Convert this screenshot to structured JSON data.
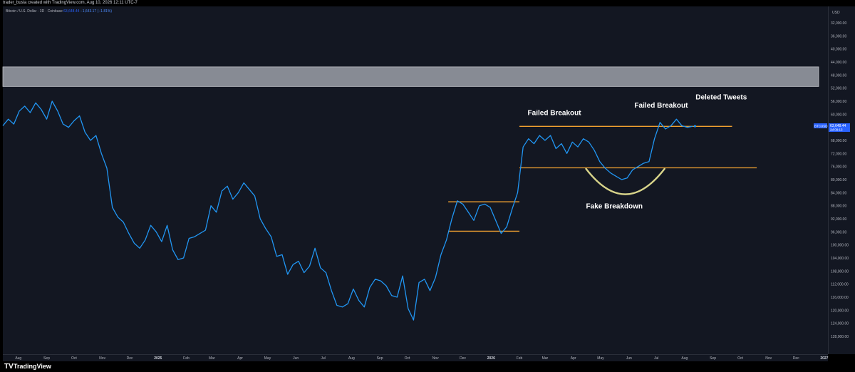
{
  "header": {
    "text": "trader_busla created with TradingView.com, Aug 10, 2026 12:11 UTC-7"
  },
  "legend": {
    "symbol": "Bitcoin / U.S. Dollar · 3D · Coinbase",
    "price": "63,648.44",
    "change": "−1,643.17 (−1.81%)"
  },
  "price_axis": {
    "currency": "USD",
    "badge_symbol": "BTCUSD",
    "badge_price": "63,648.44",
    "badge_time": "2d 09:13"
  },
  "footer": {
    "logo": "TV",
    "brand": "TradingView"
  },
  "colors": {
    "background": "#131722",
    "line": "#2196f3",
    "level": "#f0a030",
    "arc": "#d8d48a",
    "band": "#9598a1"
  },
  "chart_data": {
    "type": "line",
    "symbol": "BTCUSD",
    "y_scale": "inverted",
    "ylim": [
      30000,
      130000
    ],
    "y_ticks": [
      "32,000.00",
      "36,000.00",
      "40,000.00",
      "44,000.00",
      "48,000.00",
      "52,000.00",
      "56,000.00",
      "60,000.00",
      "64,000.00",
      "68,000.00",
      "72,000.00",
      "76,000.00",
      "80,000.00",
      "84,000.00",
      "88,000.00",
      "92,000.00",
      "96,000.00",
      "100,000.00",
      "104,000.00",
      "108,000.00",
      "112,000.00",
      "116,000.00",
      "120,000.00",
      "124,000.00",
      "128,000.00"
    ],
    "x_ticks": [
      "Aug",
      "Sep",
      "Oct",
      "Nov",
      "Dec",
      "2025",
      "Feb",
      "Mar",
      "Apr",
      "May",
      "Jun",
      "Jul",
      "Aug",
      "Sep",
      "Oct",
      "Nov",
      "Dec",
      "2026",
      "Feb",
      "Mar",
      "Apr",
      "May",
      "Jun",
      "Jul",
      "Aug",
      "Sep",
      "Oct",
      "Nov",
      "Dec",
      "2027"
    ],
    "x_range": [
      "2024-07-15",
      "2027-01-05"
    ],
    "series": [
      {
        "points": [
          [
            "2024-07-15",
            63500
          ],
          [
            "2024-07-21",
            61500
          ],
          [
            "2024-07-27",
            63000
          ],
          [
            "2024-08-02",
            59000
          ],
          [
            "2024-08-08",
            57500
          ],
          [
            "2024-08-14",
            59500
          ],
          [
            "2024-08-20",
            56500
          ],
          [
            "2024-08-26",
            58500
          ],
          [
            "2024-09-01",
            61500
          ],
          [
            "2024-09-07",
            56000
          ],
          [
            "2024-09-13",
            59000
          ],
          [
            "2024-09-19",
            63000
          ],
          [
            "2024-09-25",
            64000
          ],
          [
            "2024-10-01",
            62000
          ],
          [
            "2024-10-07",
            60500
          ],
          [
            "2024-10-13",
            65500
          ],
          [
            "2024-10-19",
            68000
          ],
          [
            "2024-10-25",
            66500
          ],
          [
            "2024-10-31",
            72000
          ],
          [
            "2024-11-06",
            76500
          ],
          [
            "2024-11-12",
            88500
          ],
          [
            "2024-11-18",
            91500
          ],
          [
            "2024-11-24",
            93000
          ],
          [
            "2024-11-30",
            96500
          ],
          [
            "2024-12-06",
            99500
          ],
          [
            "2024-12-12",
            101000
          ],
          [
            "2024-12-18",
            98500
          ],
          [
            "2024-12-24",
            94000
          ],
          [
            "2024-12-30",
            96000
          ],
          [
            "2025-01-05",
            99000
          ],
          [
            "2025-01-11",
            94000
          ],
          [
            "2025-01-17",
            101500
          ],
          [
            "2025-01-23",
            104500
          ],
          [
            "2025-01-29",
            104000
          ],
          [
            "2025-02-04",
            98000
          ],
          [
            "2025-02-10",
            97500
          ],
          [
            "2025-02-16",
            96500
          ],
          [
            "2025-02-22",
            95500
          ],
          [
            "2025-02-28",
            88000
          ],
          [
            "2025-03-06",
            90000
          ],
          [
            "2025-03-12",
            83500
          ],
          [
            "2025-03-18",
            82000
          ],
          [
            "2025-03-24",
            86000
          ],
          [
            "2025-03-30",
            84000
          ],
          [
            "2025-04-05",
            81000
          ],
          [
            "2025-04-11",
            83000
          ],
          [
            "2025-04-17",
            85000
          ],
          [
            "2025-04-23",
            92000
          ],
          [
            "2025-04-29",
            95000
          ],
          [
            "2025-05-05",
            97500
          ],
          [
            "2025-05-11",
            103500
          ],
          [
            "2025-05-17",
            103000
          ],
          [
            "2025-05-23",
            109000
          ],
          [
            "2025-05-29",
            106000
          ],
          [
            "2025-06-04",
            105000
          ],
          [
            "2025-06-10",
            108500
          ],
          [
            "2025-06-16",
            106500
          ],
          [
            "2025-06-22",
            101000
          ],
          [
            "2025-06-28",
            107000
          ],
          [
            "2025-07-04",
            108500
          ],
          [
            "2025-07-10",
            114000
          ],
          [
            "2025-07-16",
            118500
          ],
          [
            "2025-07-22",
            119000
          ],
          [
            "2025-07-28",
            118000
          ],
          [
            "2025-08-03",
            113500
          ],
          [
            "2025-08-09",
            117000
          ],
          [
            "2025-08-15",
            119000
          ],
          [
            "2025-08-21",
            113000
          ],
          [
            "2025-08-27",
            110500
          ],
          [
            "2025-09-02",
            111000
          ],
          [
            "2025-09-08",
            112500
          ],
          [
            "2025-09-14",
            115500
          ],
          [
            "2025-09-20",
            116000
          ],
          [
            "2025-09-26",
            109500
          ],
          [
            "2025-10-02",
            119500
          ],
          [
            "2025-10-08",
            123000
          ],
          [
            "2025-10-14",
            111500
          ],
          [
            "2025-10-20",
            110500
          ],
          [
            "2025-10-26",
            114000
          ],
          [
            "2025-11-01",
            110000
          ],
          [
            "2025-11-07",
            103000
          ],
          [
            "2025-11-13",
            98500
          ],
          [
            "2025-11-19",
            92000
          ],
          [
            "2025-11-25",
            86500
          ],
          [
            "2025-12-01",
            87500
          ],
          [
            "2025-12-07",
            90000
          ],
          [
            "2025-12-13",
            92500
          ],
          [
            "2025-12-19",
            88000
          ],
          [
            "2025-12-25",
            87500
          ],
          [
            "2025-12-31",
            88500
          ],
          [
            "2026-01-06",
            92500
          ],
          [
            "2026-01-12",
            96500
          ],
          [
            "2026-01-18",
            94500
          ],
          [
            "2026-01-24",
            89000
          ],
          [
            "2026-01-30",
            84000
          ],
          [
            "2026-02-05",
            70000
          ],
          [
            "2026-02-11",
            67500
          ],
          [
            "2026-02-17",
            69000
          ],
          [
            "2026-02-23",
            66500
          ],
          [
            "2026-03-01",
            68000
          ],
          [
            "2026-03-07",
            66500
          ],
          [
            "2026-03-13",
            70500
          ],
          [
            "2026-03-19",
            69000
          ],
          [
            "2026-03-25",
            72000
          ],
          [
            "2026-03-31",
            68500
          ],
          [
            "2026-04-06",
            70000
          ],
          [
            "2026-04-12",
            67500
          ],
          [
            "2026-04-18",
            68500
          ],
          [
            "2026-04-24",
            71000
          ],
          [
            "2026-04-30",
            74500
          ],
          [
            "2026-05-06",
            76500
          ],
          [
            "2026-05-12",
            78000
          ],
          [
            "2026-05-18",
            79000
          ],
          [
            "2026-05-24",
            80000
          ],
          [
            "2026-05-30",
            79500
          ],
          [
            "2026-06-05",
            77000
          ],
          [
            "2026-06-11",
            76000
          ],
          [
            "2026-06-17",
            75000
          ],
          [
            "2026-06-23",
            74500
          ],
          [
            "2026-06-29",
            67500
          ],
          [
            "2026-07-05",
            62500
          ],
          [
            "2026-07-11",
            64500
          ],
          [
            "2026-07-17",
            63500
          ],
          [
            "2026-07-23",
            61500
          ],
          [
            "2026-07-29",
            63500
          ],
          [
            "2026-08-04",
            64000
          ],
          [
            "2026-08-10",
            63648
          ]
        ]
      }
    ],
    "levels": [
      {
        "price": 95800,
        "from": "2025-11-15",
        "to": "2026-02-01"
      },
      {
        "price": 86800,
        "from": "2025-11-15",
        "to": "2026-02-01"
      },
      {
        "price": 76400,
        "from": "2026-02-01",
        "to": "2026-10-19"
      },
      {
        "price": 63700,
        "from": "2026-02-01",
        "to": "2026-09-22"
      }
    ],
    "resistance_band": {
      "from_price": 45500,
      "to_price": 51500
    },
    "annotations": [
      {
        "text": "Failed Breakout",
        "date": "2026-02-10",
        "price": 60300
      },
      {
        "text": "Failed Breakout",
        "date": "2026-06-07",
        "price": 58000
      },
      {
        "text": "Deleted Tweets",
        "date": "2026-08-13",
        "price": 55500
      },
      {
        "text": "Fake Breakdown",
        "date": "2026-04-15",
        "price": 88800
      }
    ]
  }
}
